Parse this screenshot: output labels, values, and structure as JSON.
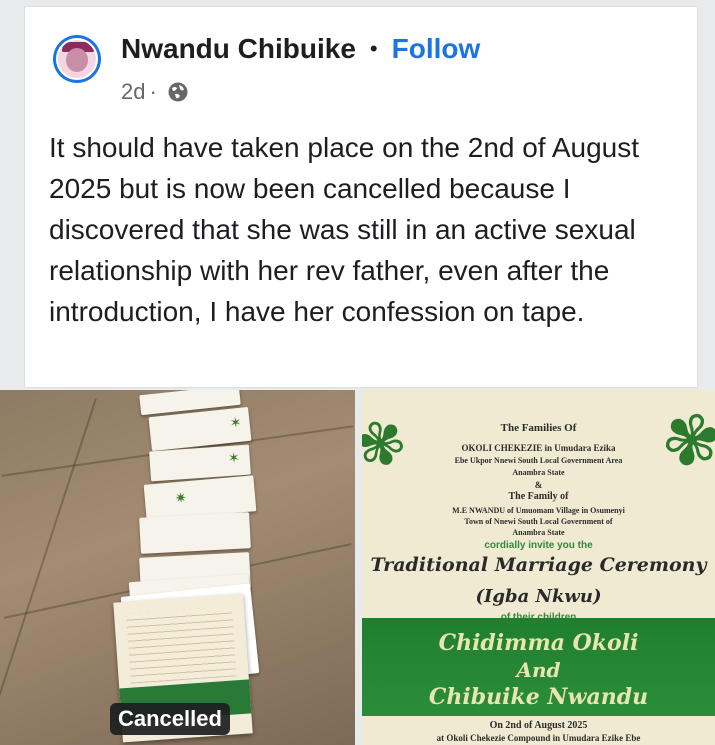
{
  "post": {
    "author": "Nwandu Chibuike",
    "separator": "•",
    "follow_label": "Follow",
    "time": "2d",
    "meta_sep": "·",
    "text": "It should have taken place on the 2nd of August 2025 but is now been cancelled because I discovered that she was still in an active sexual relationship with her rev father, even after the introduction, I have her confession on tape."
  },
  "photos": {
    "left_badge": "Cancelled"
  },
  "invitation": {
    "line1": "The Families Of",
    "line2": "OKOLI CHEKEZIE in Umudara Ezika",
    "line3": "Ebe Ukpor Nnewi South Local Government Area",
    "line4": "Anambra State",
    "line5": "&",
    "line6": "The Family of",
    "line7": "M.E NWANDU of Umuomam Village in Osumenyi",
    "line8": "Town of Nnewi South Local Government of",
    "line9": "Anambra State",
    "line10": "cordially invite you the",
    "script1": "Traditional Marriage Ceremony",
    "script2": "(Igba Nkwu)",
    "line11": "of their children",
    "name1": "Chidimma Okoli",
    "and": "And",
    "name2": "Chibuike Nwandu",
    "line12": "On 2nd of August 2025",
    "line13": "at Okoli Chekezie Compound in Umudara Ezike Ebe"
  },
  "colors": {
    "link": "#1b74e4",
    "text": "#1c1e21",
    "meta": "#65676b",
    "band_green": "#2b8d3a"
  },
  "icons": [
    "globe-icon"
  ]
}
